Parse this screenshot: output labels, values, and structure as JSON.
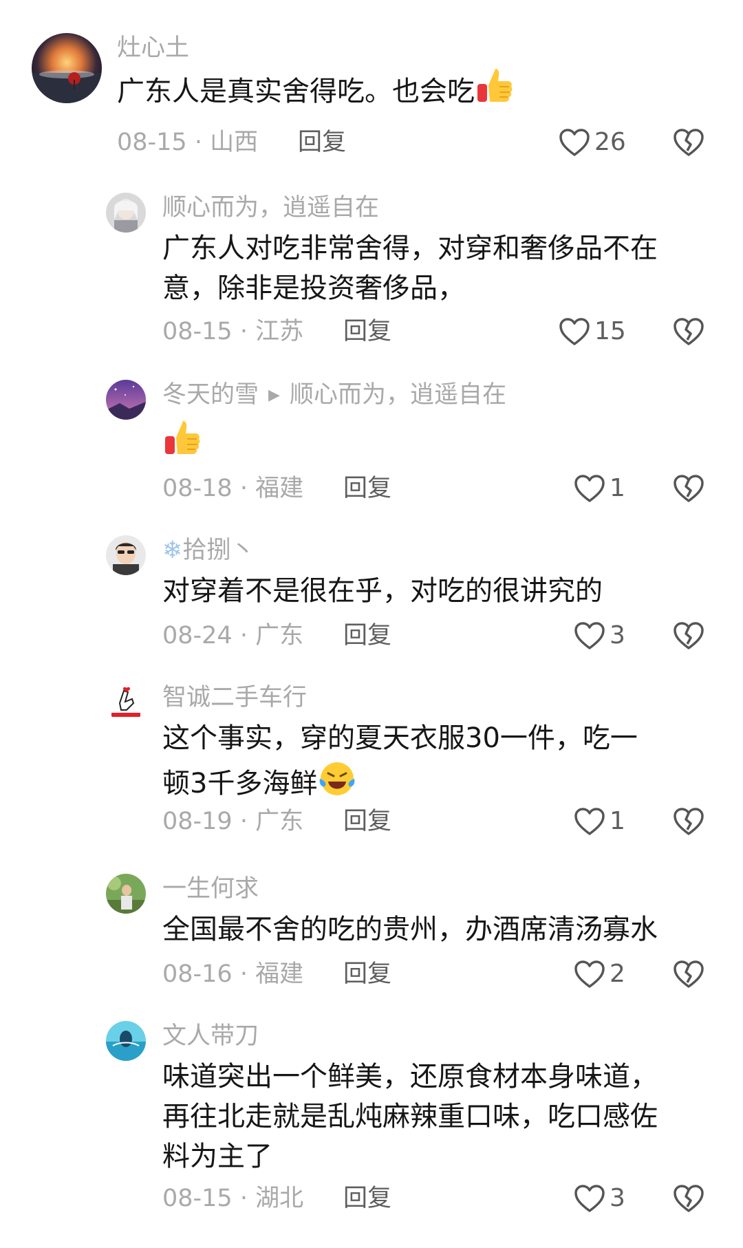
{
  "comments": [
    {
      "user": "灶心土",
      "text_lines": [
        "广东人是真实舍得吃。也会吃"
      ],
      "date": "08-15",
      "region": "山西",
      "reply_label": "回复",
      "likes": "26",
      "emoji": "thumbs-up-icon"
    },
    {
      "user": "顺心而为，逍遥自在",
      "text_lines": [
        "广东人对吃非常舍得，对穿和奢侈品不在",
        "意，除非是投资奢侈品，"
      ],
      "date": "08-15",
      "region": "江苏",
      "reply_label": "回复",
      "likes": "15"
    },
    {
      "user": "冬天的雪",
      "reply_to": "顺心而为，逍遥自在",
      "text_lines": [
        ""
      ],
      "date": "08-18",
      "region": "福建",
      "reply_label": "回复",
      "likes": "1",
      "emoji": "thumbs-up-icon"
    },
    {
      "user": "拾捌丶",
      "text_lines": [
        "对穿着不是很在乎，对吃的很讲究的"
      ],
      "date": "08-24",
      "region": "广东",
      "reply_label": "回复",
      "likes": "3"
    },
    {
      "user": "智诚二手车行",
      "text_lines": [
        "这个事实，穿的夏天衣服30一件，吃一",
        "顿3千多海鲜"
      ],
      "date": "08-19",
      "region": "广东",
      "reply_label": "回复",
      "likes": "1",
      "emoji": "crying-laugh-icon"
    },
    {
      "user": "一生何求",
      "text_lines": [
        "全国最不舍的吃的贵州，办酒席清汤寡水"
      ],
      "date": "08-16",
      "region": "福建",
      "reply_label": "回复",
      "likes": "2"
    },
    {
      "user": "文人带刀",
      "text_lines": [
        "味道突出一个鲜美，还原食材本身味道，",
        "再往北走就是乱炖麻辣重口味，吃口感佐",
        "料为主了"
      ],
      "date": "08-15",
      "region": "湖北",
      "reply_label": "回复",
      "likes": "3"
    }
  ],
  "meta_separator": " · ",
  "colors": {
    "text": "#161616",
    "muted": "#a9a9a9",
    "reply": "#5e5e5e"
  }
}
